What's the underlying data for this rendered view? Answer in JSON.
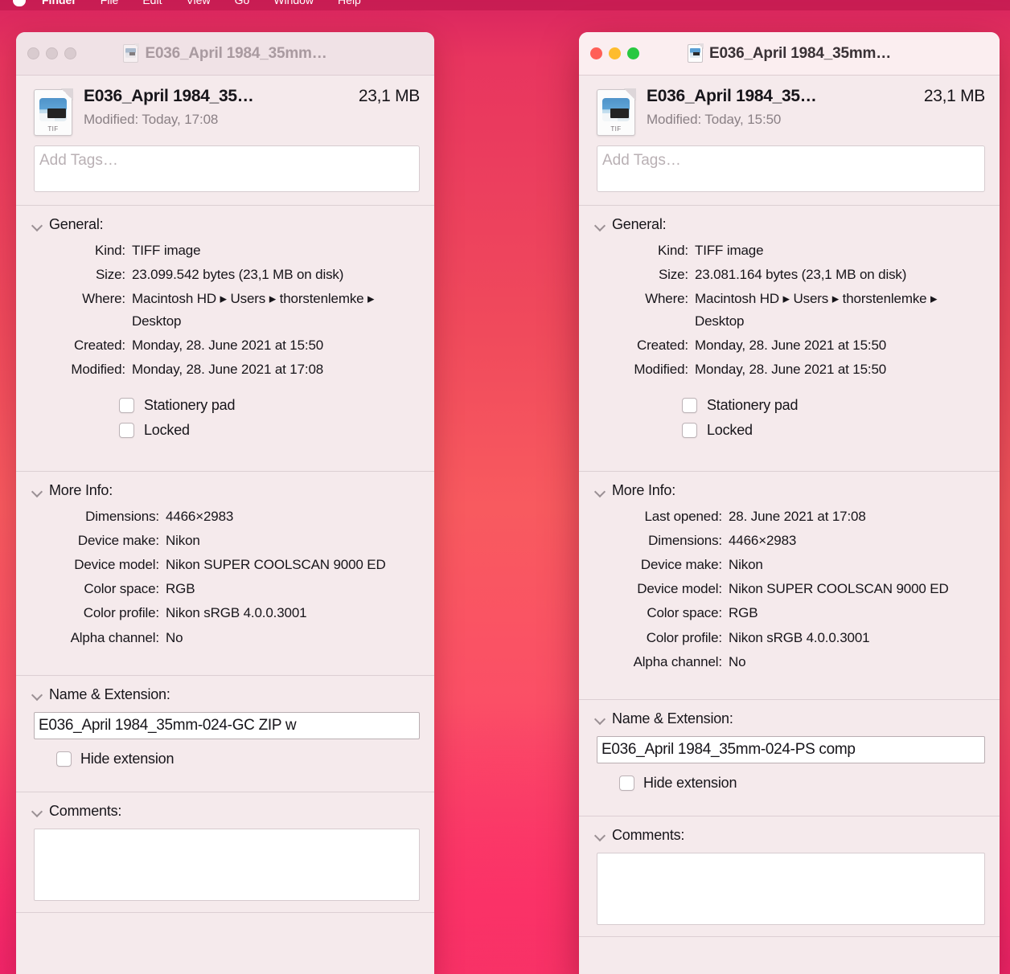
{
  "menubar": {
    "apple": "",
    "items": [
      "Finder",
      "File",
      "Edit",
      "View",
      "Go",
      "Window",
      "Help"
    ]
  },
  "colors": {
    "desktop_top": "#d9255f",
    "desktop_mid": "#f85a5f",
    "desktop_bottom": "#ef1f6b",
    "panel_bg": "#f5eaec",
    "titlebar_active": "#fbeef0",
    "titlebar_inactive": "#f0e2e6",
    "traffic_close": "#ff5f57",
    "traffic_min": "#febc2e",
    "traffic_max": "#28c840",
    "label_text": "#17151a",
    "secondary_text": "#8a8085"
  },
  "windows": [
    {
      "state": "inactive",
      "titlebar": {
        "title": "E036_April 1984_35mm…",
        "file_icon": "tiff-document-icon"
      },
      "header": {
        "name": "E036_April 1984_35…",
        "size": "23,1 MB",
        "modified": "Modified: Today, 17:08",
        "icon_ext_label": "TIF"
      },
      "tags": {
        "placeholder": "Add Tags…"
      },
      "general": {
        "title": "General:",
        "rows": [
          {
            "key": "Kind:",
            "value": "TIFF image"
          },
          {
            "key": "Size:",
            "value": "23.099.542 bytes (23,1 MB on disk)"
          },
          {
            "key": "Where:",
            "value": "Macintosh HD ▸ Users ▸ thorstenlemke ▸ Desktop"
          },
          {
            "key": "Created:",
            "value": "Monday, 28. June 2021 at 15:50"
          },
          {
            "key": "Modified:",
            "value": "Monday, 28. June 2021 at 17:08"
          }
        ],
        "checkboxes": [
          {
            "label": "Stationery pad",
            "checked": false
          },
          {
            "label": "Locked",
            "checked": false
          }
        ]
      },
      "more_info": {
        "title": "More Info:",
        "rows": [
          {
            "key": "Dimensions:",
            "value": "4466×2983"
          },
          {
            "key": "Device make:",
            "value": "Nikon"
          },
          {
            "key": "Device model:",
            "value": "Nikon SUPER COOLSCAN 9000 ED"
          },
          {
            "key": "Color space:",
            "value": "RGB"
          },
          {
            "key": "Color profile:",
            "value": "Nikon sRGB 4.0.0.3001"
          },
          {
            "key": "Alpha channel:",
            "value": "No"
          }
        ]
      },
      "name_extension": {
        "title": "Name & Extension:",
        "value": "E036_April 1984_35mm-024-GC ZIP w",
        "hide_extension_label": "Hide extension",
        "hide_extension_checked": false
      },
      "comments": {
        "title": "Comments:",
        "value": ""
      }
    },
    {
      "state": "active",
      "titlebar": {
        "title": "E036_April 1984_35mm…",
        "file_icon": "tiff-document-icon"
      },
      "header": {
        "name": "E036_April 1984_35…",
        "size": "23,1 MB",
        "modified": "Modified: Today, 15:50",
        "icon_ext_label": "TIF"
      },
      "tags": {
        "placeholder": "Add Tags…"
      },
      "general": {
        "title": "General:",
        "rows": [
          {
            "key": "Kind:",
            "value": "TIFF image"
          },
          {
            "key": "Size:",
            "value": "23.081.164 bytes (23,1 MB on disk)"
          },
          {
            "key": "Where:",
            "value": "Macintosh HD ▸ Users ▸ thorstenlemke ▸ Desktop"
          },
          {
            "key": "Created:",
            "value": "Monday, 28. June 2021 at 15:50"
          },
          {
            "key": "Modified:",
            "value": "Monday, 28. June 2021 at 15:50"
          }
        ],
        "checkboxes": [
          {
            "label": "Stationery pad",
            "checked": false
          },
          {
            "label": "Locked",
            "checked": false
          }
        ]
      },
      "more_info": {
        "title": "More Info:",
        "rows": [
          {
            "key": "Last opened:",
            "value": "28. June 2021 at 17:08"
          },
          {
            "key": "Dimensions:",
            "value": "4466×2983"
          },
          {
            "key": "Device make:",
            "value": "Nikon"
          },
          {
            "key": "Device model:",
            "value": "Nikon SUPER COOLSCAN 9000 ED"
          },
          {
            "key": "Color space:",
            "value": "RGB"
          },
          {
            "key": "Color profile:",
            "value": "Nikon sRGB 4.0.0.3001"
          },
          {
            "key": "Alpha channel:",
            "value": "No"
          }
        ]
      },
      "name_extension": {
        "title": "Name & Extension:",
        "value": "E036_April 1984_35mm-024-PS comp",
        "hide_extension_label": "Hide extension",
        "hide_extension_checked": false
      },
      "comments": {
        "title": "Comments:",
        "value": ""
      }
    }
  ]
}
